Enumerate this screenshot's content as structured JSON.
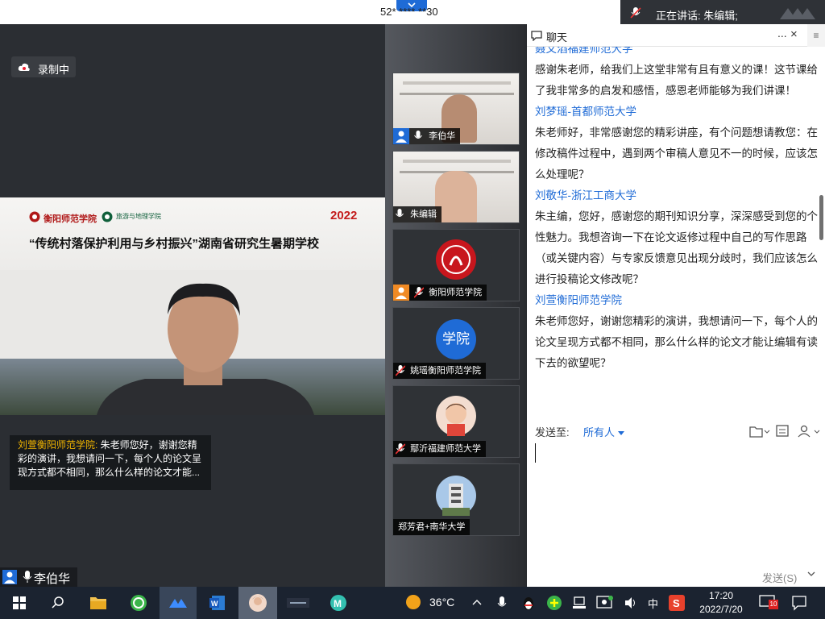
{
  "meeting": {
    "id_masked": "52* **** **30",
    "speaking_label": "正在讲话: 朱编辑;",
    "recording_label": "录制中"
  },
  "main_video": {
    "logo_text": "衡阳师范学院",
    "logo2_text": "旅游与地理学院",
    "banner_year": "2022",
    "banner_title": "“传统村落保护利用与乡村振兴”湖南省研究生暑期学校",
    "caption_sender": "刘萱衡阳师范学院:",
    "caption_text": " 朱老师您好，谢谢您精彩的演讲，我想请问一下，每个人的论文呈现方式都不相同，那么什么样的论文才能...",
    "speaker_name": "李伯华"
  },
  "participants": [
    {
      "name": "李伯华",
      "kind": "screen-face",
      "avatar": true,
      "mic_muted": false
    },
    {
      "name": "朱编辑",
      "kind": "screen-face2",
      "avatar": false,
      "mic_muted": false
    },
    {
      "name": "衡阳师范学院",
      "kind": "logo",
      "avatar": true,
      "mic_muted": true
    },
    {
      "name": "姚瑶衡阳师范学院",
      "kind": "text-avatar",
      "avatar_text": "学院",
      "avatar": false,
      "mic_muted": true
    },
    {
      "name": "鄢沂福建师范大学",
      "kind": "child-avatar",
      "avatar": false,
      "mic_muted": true
    },
    {
      "name": "郑芳君+南华大学",
      "kind": "building-avatar",
      "avatar": false,
      "mic_muted": null
    }
  ],
  "chat": {
    "title": "聊天",
    "more_icon": "...",
    "close_icon": "×",
    "side_icon": "≡",
    "messages": [
      {
        "sender": "聂文滔福建师范大学",
        "text": "感谢朱老师，给我们上这堂非常有且有意义的课！这节课给了我非常多的启发和感悟，感恩老师能够为我们讲课！"
      },
      {
        "sender": "刘梦瑶-首都师范大学",
        "text": "朱老师好，非常感谢您的精彩讲座，有个问题想请教您：在修改稿件过程中，遇到两个审稿人意见不一的时候，应该怎么处理呢？"
      },
      {
        "sender": "刘敬华-浙江工商大学",
        "text": "朱主编，您好，感谢您的期刊知识分享，深深感受到您的个性魅力。我想咨询一下在论文返修过程中自己的写作思路（或关键内容）与专家反馈意见出现分歧时，我们应该怎么进行投稿论文修改呢？"
      },
      {
        "sender": "刘萱衡阳师范学院",
        "text": "朱老师您好，谢谢您精彩的演讲，我想请问一下，每个人的论文呈现方式都不相同，那么什么样的论文才能让编辑有读下去的欲望呢？"
      }
    ],
    "send_to_label": "发送至:",
    "recipient": "所有人",
    "send_button": "发送(S)"
  },
  "taskbar": {
    "temperature": "36°C",
    "ime": "中",
    "time": "17:20",
    "date": "2022/7/20",
    "notification_count": "10",
    "items": [
      "windows-start",
      "search",
      "file-explorer",
      "360-browser",
      "tencent-meeting",
      "word",
      "photo",
      "video-app",
      "app-m"
    ]
  },
  "colors": {
    "accent": "#1f6bd6",
    "caption_name": "#f0b400",
    "banner_red": "#c41b1b"
  }
}
